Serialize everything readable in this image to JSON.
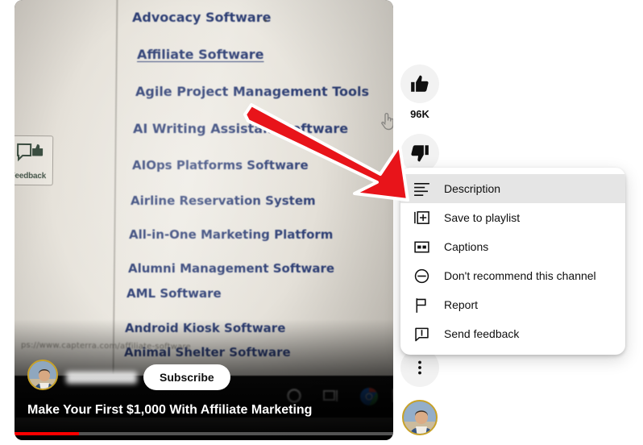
{
  "video": {
    "title": "Make Your First $1,000 With Affiliate Marketing",
    "subscribe_label": "Subscribe",
    "channel_name_redacted": "",
    "progress_percent": 17,
    "progress_color": "#ff0000",
    "url_overlay_text": "ps://www.capterra.com/affiliate-software",
    "feedback_widget_label": "Feedback",
    "cursor_icon": "pointing-hand-icon",
    "categories": [
      {
        "label": "Advocacy Software",
        "underlined": false
      },
      {
        "label": "Affiliate Software",
        "underlined": true
      },
      {
        "label": "Agile Project Management Tools",
        "underlined": false
      },
      {
        "label": "AI Writing Assistant Software",
        "underlined": false
      },
      {
        "label": "AIOps Platforms Software",
        "underlined": false
      },
      {
        "label": "Airline Reservation System",
        "underlined": false
      },
      {
        "label": "All-in-One Marketing Platform",
        "underlined": false
      },
      {
        "label": "Alumni Management Software",
        "underlined": false
      },
      {
        "label": "AML Software",
        "underlined": false
      },
      {
        "label": "Android Kiosk Software",
        "underlined": false
      },
      {
        "label": "Animal Shelter Software",
        "underlined": false
      }
    ]
  },
  "rail": {
    "like_count": "96K",
    "like_icon": "thumbs-up-icon",
    "dislike_icon": "thumbs-down-icon",
    "more_icon": "more-vertical-icon",
    "avatar_icon": "user-avatar"
  },
  "menu": {
    "items": [
      {
        "label": "Description",
        "icon": "description-icon",
        "active": true
      },
      {
        "label": "Save to playlist",
        "icon": "save-playlist-icon",
        "active": false
      },
      {
        "label": "Captions",
        "icon": "captions-icon",
        "active": false
      },
      {
        "label": "Don't recommend this channel",
        "icon": "do-not-recommend-icon",
        "active": false
      },
      {
        "label": "Report",
        "icon": "flag-icon",
        "active": false
      },
      {
        "label": "Send feedback",
        "icon": "send-feedback-icon",
        "active": false
      }
    ],
    "highlight_color": "#e5e5e5"
  },
  "annotation": {
    "arrow_color": "#e8141a",
    "arrow_outline": "#ffffff"
  }
}
